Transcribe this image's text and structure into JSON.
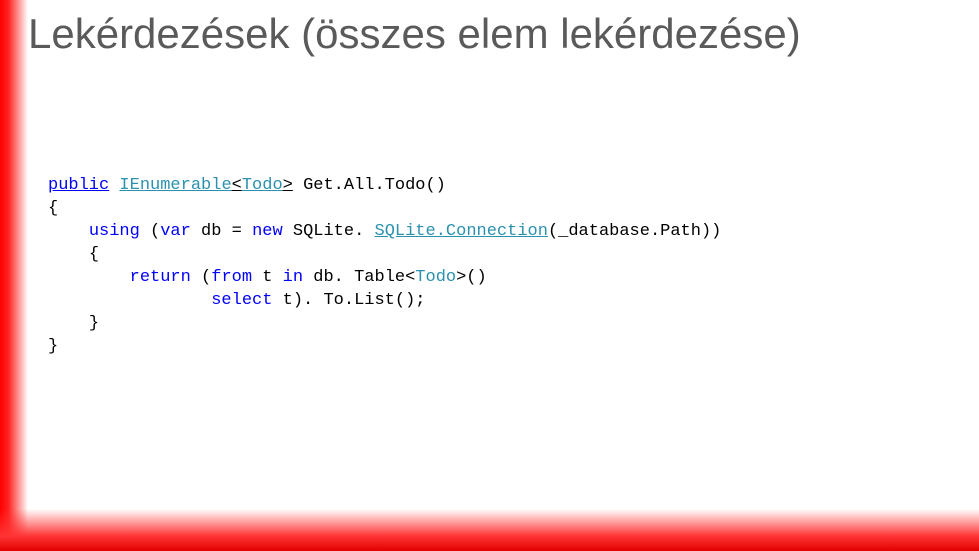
{
  "title": "Lekérdezések (összes elem lekérdezése)",
  "code": {
    "kw_public": "public",
    "typ_ienum": "IEnumerable",
    "lt1": "<",
    "typ_todo": "Todo",
    "gt1": ">",
    "sp1": " ",
    "fn_name": "Get.All.Todo()",
    "brace_open1": "{",
    "indent1": "    ",
    "kw_using": "using",
    "sp2": " (",
    "kw_var": "var",
    "sp3": " db = ",
    "kw_new": "new",
    "sp4": " SQLite. ",
    "typ_conn": "SQLite.Connection",
    "conn_args": "(_database.Path))",
    "brace_open2": "{",
    "indent2": "        ",
    "kw_return": "return",
    "sp5": " (",
    "kw_from": "from",
    "sp6": " t ",
    "kw_in": "in",
    "sp7": " db. Table<",
    "typ_todo2": "Todo",
    "sp8": ">()",
    "indent3": "                ",
    "kw_select": "select",
    "sp9": " t). To.List();",
    "brace_close2": "}",
    "brace_close1": "}"
  }
}
